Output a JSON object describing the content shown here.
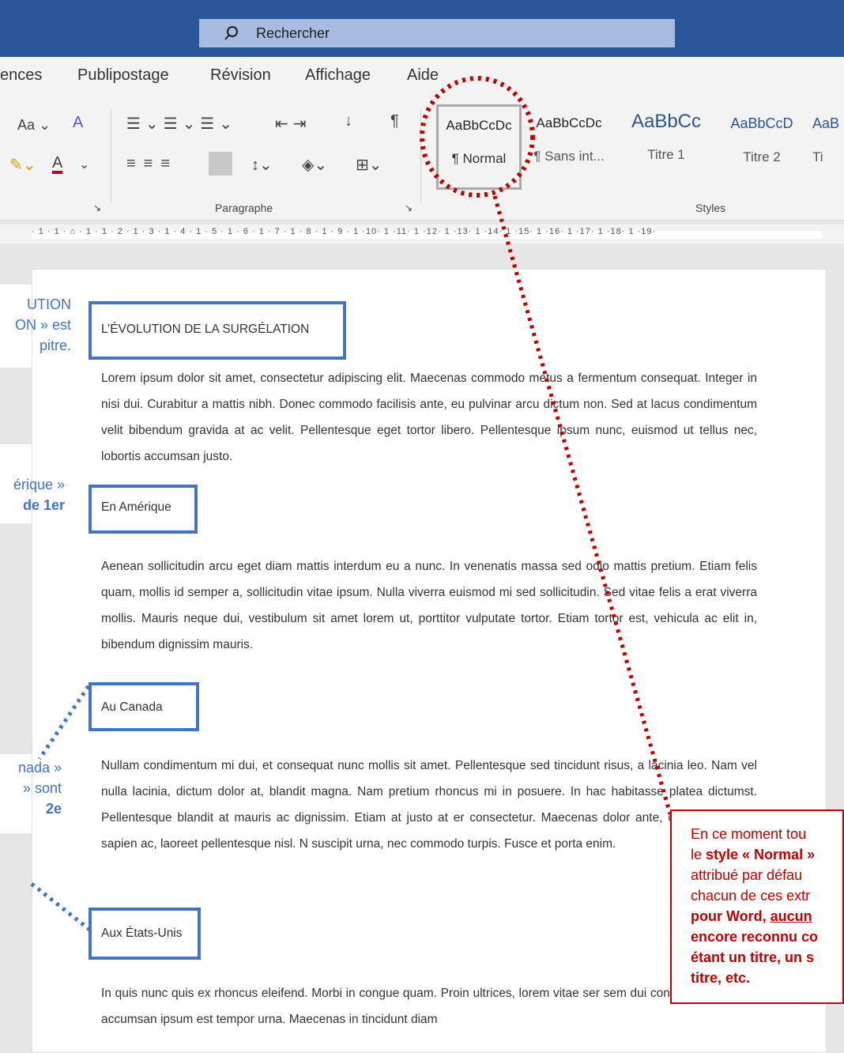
{
  "search": {
    "placeholder": "Rechercher"
  },
  "tabs": [
    "ences",
    "Publipostage",
    "Révision",
    "Affichage",
    "Aide"
  ],
  "ribbon": {
    "font_size_label": "Aa",
    "paragraph_label": "Paragraphe",
    "styles_label": "Styles",
    "styles": [
      {
        "sample": "AaBbCcDc",
        "name": "¶ Normal"
      },
      {
        "sample": "AaBbCcDc",
        "name": "¶ Sans int..."
      },
      {
        "sample": "AaBbCc",
        "name": "Titre 1"
      },
      {
        "sample": "AaBbCcD",
        "name": "Titre 2"
      },
      {
        "sample": "AaB",
        "name": "Ti"
      }
    ]
  },
  "ruler": {
    "numbers": "· 1 · 1 · ⌂ · 1 · 1 · 2 · 1 · 3 · 1 · 4 · 1 · 5 · 1 · 6 · 1 · 7 · 1 · 8 · 1 · 9 · 1 ·10· 1 ·11· 1 ·12· 1 ·13· 1 ·14· 1 ·15· 1 ·16· 1 ·17· 1 ·18· 1 ·19·"
  },
  "document": {
    "title": "L’ÉVOLUTION DE LA SURGÉLATION",
    "p1": "Lorem ipsum dolor sit amet, consectetur adipiscing elit. Maecenas commodo metus a fermentum consequat. Integer in nisi dui. Curabitur a mattis nibh. Donec commodo facilisis ante, eu pulvinar arcu dictum non. Sed at lacus condimentum velit bibendum gravida at ac velit. Pellentesque eget tortor libero. Pellentesque ipsum nunc, euismod ut tellus nec, lobortis accumsan justo.",
    "h_amerique": "En Amérique",
    "p2": "Aenean sollicitudin arcu eget diam mattis interdum eu a nunc. In venenatis massa sed odio mattis pretium. Etiam felis quam, mollis id semper a, sollicitudin vitae ipsum. Nulla viverra euismod mi sed sollicitudin. Sed vitae felis a erat viverra mollis. Mauris neque dui, vestibulum sit amet lorem ut, porttitor vulputate tortor. Etiam tortor est, vehicula ac elit in, bibendum dignissim mauris.",
    "h_canada": "Au Canada",
    "p3": "Nullam condimentum mi dui, et consequat nunc mollis sit amet. Pellentesque sed tincidunt risus, a lacinia leo. Nam vel nulla lacinia, dictum dolor at, blandit magna. Nam pretium rhoncus mi in posuere. In hac habitasse platea dictumst. Pellentesque blandit at mauris ac dignissim. Etiam at justo at er consectetur. Maecenas dolor ante, condimentum et sapien ac, laoreet pellentesque nisl. N suscipit urna, nec commodo turpis. Fusce et porta enim.",
    "h_etats_unis": "Aux États-Unis",
    "p4": "In quis nunc quis ex rhoncus eleifend. Morbi in congue quam. Proin ultrices, lorem vitae ser sem dui convallis tellus, non accumsan ipsum est tempor urna. Maecenas in tincidunt diam"
  },
  "notes": {
    "n1_line1": "UTION",
    "n1_line2": "ON » est",
    "n1_line3": "pitre.",
    "n2_line1": "érique »",
    "n2_line2": "de 1er",
    "n3_line1": "nada »",
    "n3_line2": "» sont",
    "n3_line3": "2e"
  },
  "callout": {
    "l1": "En ce moment tou",
    "l2_pre": "le ",
    "l2_bold": "style « Normal »",
    "l3": "attribué par défau",
    "l4": "chacun de ces extr",
    "l5_bold": "pour Word, ",
    "l5_under": "aucun",
    "l6_bold": "encore reconnu co",
    "l7_bold": "étant un titre, un s",
    "l8_bold": "titre, etc."
  },
  "colors": {
    "word_blue": "#2b579a",
    "annot_blue": "#4472c4",
    "annot_red": "#c00000"
  }
}
